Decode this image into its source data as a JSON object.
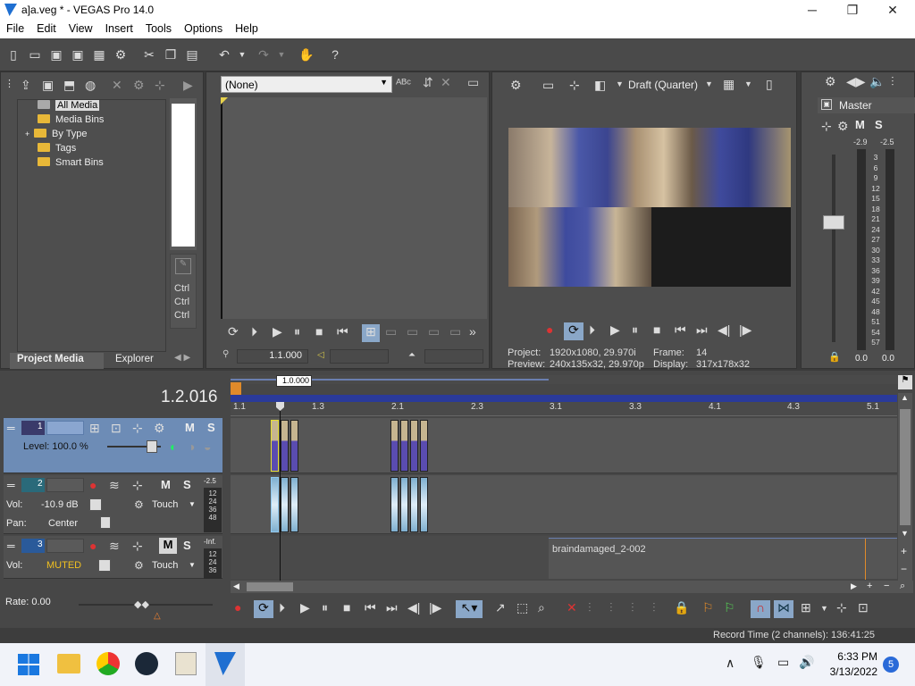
{
  "window": {
    "title": "a]a.veg * - VEGAS Pro 14.0",
    "minimize": "─",
    "maximize": "❐",
    "close": "✕"
  },
  "menu": [
    "File",
    "Edit",
    "View",
    "Insert",
    "Tools",
    "Options",
    "Help"
  ],
  "project_media": {
    "tree": [
      "All Media",
      "Media Bins",
      "By Type",
      "Tags",
      "Smart Bins"
    ],
    "expander": "+",
    "tabs": [
      "Project Media",
      "Explorer"
    ]
  },
  "trimmer": {
    "dropdown": "(None)",
    "timecode": "1.1.000",
    "ctrl_labels": [
      "Ctrl",
      "Ctrl",
      "Ctrl"
    ]
  },
  "preview": {
    "quality": "Draft (Quarter)",
    "project_label": "Project:",
    "project_value": "1920x1080, 29.970i",
    "frame_label": "Frame:",
    "frame_value": "14",
    "preview_label": "Preview:",
    "preview_value": "240x135x32, 29.970p",
    "display_label": "Display:",
    "display_value": "317x178x32"
  },
  "master": {
    "title": "Master",
    "m": "M",
    "s": "S",
    "db_top": [
      "-2.9",
      "-2.5"
    ],
    "scale": [
      "3",
      "6",
      "9",
      "12",
      "15",
      "18",
      "21",
      "24",
      "27",
      "30",
      "33",
      "36",
      "39",
      "42",
      "45",
      "48",
      "51",
      "54",
      "57"
    ],
    "db_bottom": [
      "0.0",
      "0.0"
    ]
  },
  "timeline": {
    "cursor_time": "1.2.016",
    "cursor_tag": "1.0.000",
    "ruler": [
      "1.1",
      "1.3",
      "2.1",
      "2.3",
      "3.1",
      "3.3",
      "4.1",
      "4.3",
      "5.1"
    ],
    "rate": "Rate: 0.00",
    "tracks": [
      {
        "num": "1",
        "level": "Level: 100.0 %",
        "m": "M",
        "s": "S"
      },
      {
        "num": "2",
        "vol": "Vol:",
        "vol_value": "-10.9 dB",
        "pan": "Pan:",
        "pan_value": "Center",
        "mode": "Touch",
        "m": "M",
        "s": "S",
        "db": "-2.5",
        "scale": [
          "12",
          "24",
          "36",
          "48"
        ]
      },
      {
        "num": "3",
        "vol": "Vol:",
        "vol_value": "MUTED",
        "mode": "Touch",
        "m": "M",
        "s": "S",
        "db": "-Inf.",
        "scale": [
          "12",
          "24",
          "36"
        ]
      }
    ],
    "event_label": "braindamaged_2-002"
  },
  "status": {
    "record_time": "Record Time (2 channels): 136:41:25"
  },
  "taskbar": {
    "time": "6:33 PM",
    "date": "3/13/2022",
    "badge": "5"
  }
}
